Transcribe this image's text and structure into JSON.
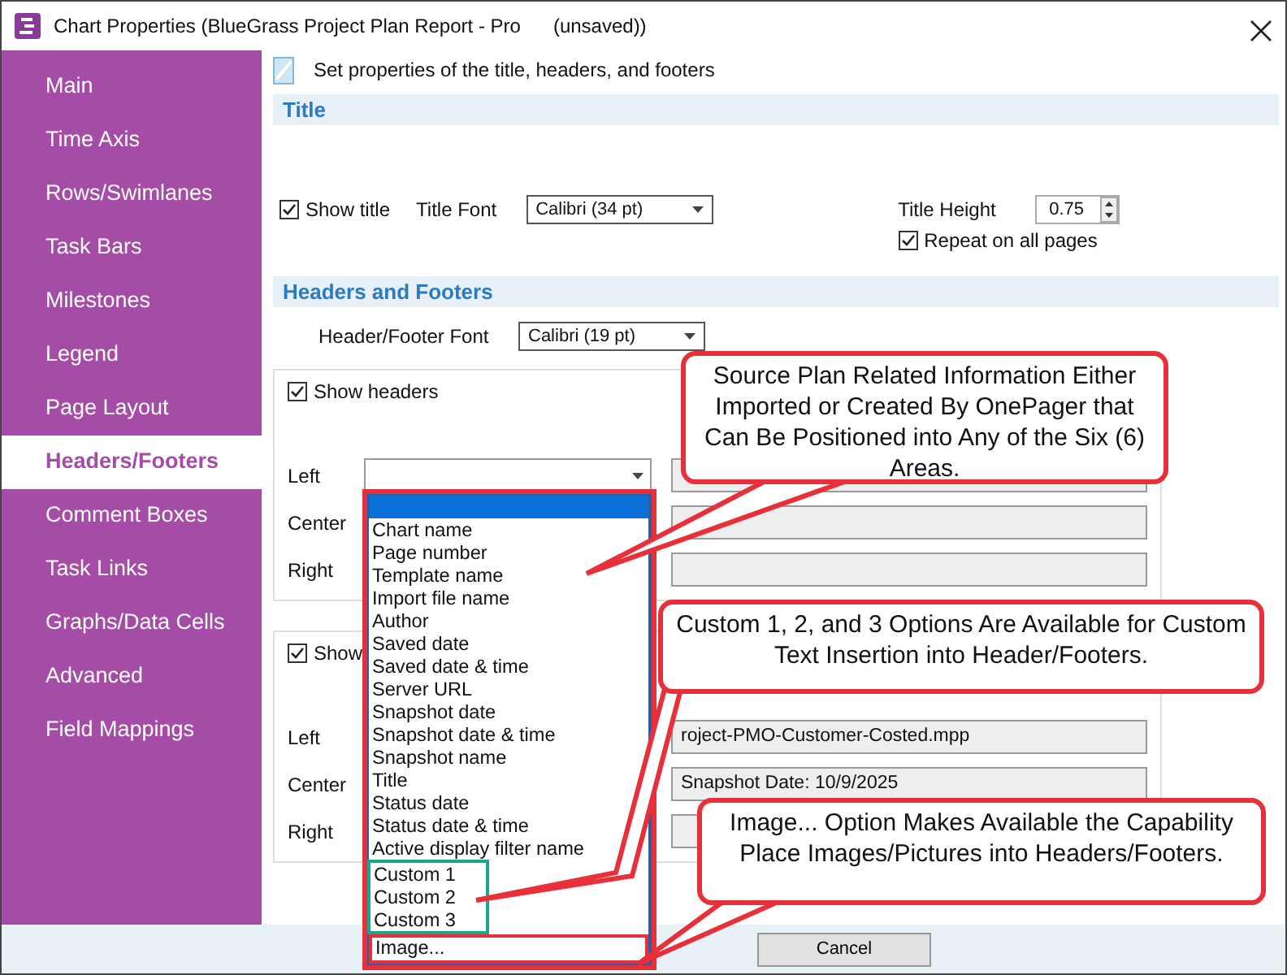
{
  "window": {
    "title": "Chart Properties (BlueGrass Project Plan Report - Pro      (unsaved))"
  },
  "sidebar": {
    "items": [
      {
        "label": "Main",
        "selected": false
      },
      {
        "label": "Time Axis",
        "selected": false
      },
      {
        "label": "Rows/Swimlanes",
        "selected": false
      },
      {
        "label": "Task Bars",
        "selected": false
      },
      {
        "label": "Milestones",
        "selected": false
      },
      {
        "label": "Legend",
        "selected": false
      },
      {
        "label": "Page Layout",
        "selected": false
      },
      {
        "label": "Headers/Footers",
        "selected": true
      },
      {
        "label": "Comment Boxes",
        "selected": false
      },
      {
        "label": "Task Links",
        "selected": false
      },
      {
        "label": "Graphs/Data Cells",
        "selected": false
      },
      {
        "label": "Advanced",
        "selected": false
      },
      {
        "label": "Field Mappings",
        "selected": false
      }
    ]
  },
  "description": "Set properties of the title, headers, and footers",
  "title_section": {
    "heading": "Title",
    "show_title": {
      "label": "Show title",
      "checked": true
    },
    "font_label": "Title Font",
    "font_value": "Calibri (34 pt)",
    "height_label": "Title Height",
    "height_value": "0.75",
    "repeat": {
      "label": "Repeat on all pages",
      "checked": true
    }
  },
  "headers_footers": {
    "heading": "Headers and Footers",
    "font_label": "Header/Footer Font",
    "font_value": "Calibri (19 pt)",
    "headers": {
      "show": {
        "label": "Show headers",
        "checked": true
      },
      "rows": [
        {
          "label": "Left"
        },
        {
          "label": "Center"
        },
        {
          "label": "Right"
        }
      ]
    },
    "footers": {
      "show": {
        "label": "Show",
        "checked": true
      },
      "rows": [
        {
          "label": "Left",
          "value": "roject-PMO-Customer-Costed.mpp"
        },
        {
          "label": "Center",
          "value": "Snapshot Date: 10/9/2025"
        },
        {
          "label": "Right"
        }
      ]
    }
  },
  "dropdown": {
    "blank_row_selected": true,
    "items": [
      {
        "label": "Chart name",
        "kind": "standard"
      },
      {
        "label": "Page number",
        "kind": "standard"
      },
      {
        "label": "Template name",
        "kind": "standard"
      },
      {
        "label": "Import file name",
        "kind": "standard"
      },
      {
        "label": "Author",
        "kind": "standard"
      },
      {
        "label": "Saved date",
        "kind": "standard"
      },
      {
        "label": "Saved date & time",
        "kind": "standard"
      },
      {
        "label": "Server URL",
        "kind": "standard"
      },
      {
        "label": "Snapshot date",
        "kind": "standard"
      },
      {
        "label": "Snapshot date & time",
        "kind": "standard"
      },
      {
        "label": "Snapshot name",
        "kind": "standard"
      },
      {
        "label": "Title",
        "kind": "standard"
      },
      {
        "label": "Status date",
        "kind": "standard"
      },
      {
        "label": "Status date & time",
        "kind": "standard"
      },
      {
        "label": "Active display filter name",
        "kind": "standard"
      },
      {
        "label": "Custom 1",
        "kind": "custom"
      },
      {
        "label": "Custom 2",
        "kind": "custom"
      },
      {
        "label": "Custom 3",
        "kind": "custom"
      },
      {
        "label": "Image...",
        "kind": "image"
      }
    ]
  },
  "callouts": [
    {
      "text": "Source Plan Related Information Either Imported or Created By OnePager that Can Be Positioned into Any of the Six (6) Areas."
    },
    {
      "text": "Custom 1, 2, and 3 Options Are Available for Custom Text Insertion into Header/Footers."
    },
    {
      "text": "Image... Option Makes Available the Capability Place Images/Pictures into Headers/Footers."
    }
  ],
  "buttons": [
    "Cancel"
  ]
}
